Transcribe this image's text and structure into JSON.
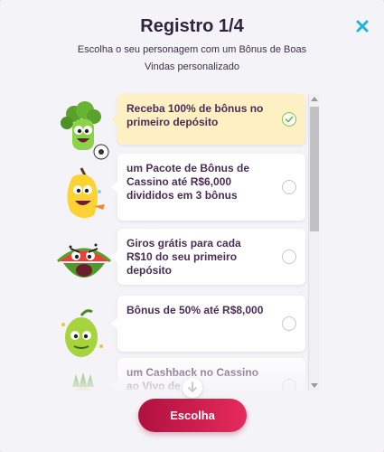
{
  "header": {
    "title": "Registro 1/4",
    "subtitle": "Escolha o seu personagem com um Bônus de Boas Vindas personalizado"
  },
  "options": [
    {
      "text": "Receba 100% de bônus no primeiro depósito",
      "selected": true,
      "character": "broccoli-character"
    },
    {
      "text": "um Pacote de Bônus de Cassino até R$6,000 divididos em 3 bônus",
      "selected": false,
      "character": "banana-character"
    },
    {
      "text": "Giros grátis para cada R$10 do seu primeiro depósito",
      "selected": false,
      "character": "watermelon-character"
    },
    {
      "text": "Bônus de 50% até R$8,000",
      "selected": false,
      "character": "lime-character"
    },
    {
      "text": "um Cashback no Cassino ao Vivo de até",
      "selected": false,
      "character": "pineapple-character"
    }
  ],
  "footer": {
    "button_label": "Escolha"
  },
  "colors": {
    "title": "#2f2440",
    "close": "#1fb6d8",
    "selected_card": "#fdf1c3",
    "check": "#7cc24a",
    "button_start": "#b0113f",
    "button_end": "#e72a5c"
  }
}
